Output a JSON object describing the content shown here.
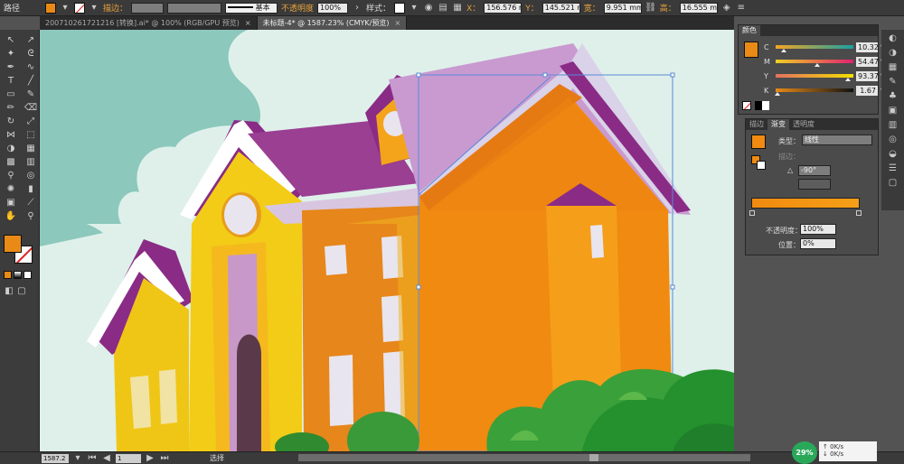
{
  "control_bar": {
    "type_label": "路径",
    "stroke_label": "描边：",
    "stroke_style_label": "基本",
    "opacity_label": "不透明度",
    "opacity_value": "100%",
    "style_label": "样式：",
    "x_label": "X：",
    "x_value": "156.576 r",
    "y_label": "Y：",
    "y_value": "145.521 r",
    "w_label": "宽：",
    "w_value": "9.951 mm",
    "h_label": "高：",
    "h_value": "16.555 mm",
    "fill_color": "#e98a17",
    "stroke_color": "#ffffff"
  },
  "tabs": [
    {
      "label": "20071026172121​6 [转换].ai* @ 100% (RGB/GPU 预览)",
      "active": false
    },
    {
      "label": "未标题-4* @ 1587.23% (CMYK/预览)",
      "active": true
    }
  ],
  "tab_close": "×",
  "color_panel": {
    "title": "颜色",
    "swatch": "#e98a17",
    "sliders": [
      {
        "label": "C",
        "value": "10.32",
        "unit": "%",
        "pos": 0.1,
        "grad": "linear-gradient(to right,#f4a623,#1aa0a0)"
      },
      {
        "label": "M",
        "value": "54.47",
        "unit": "%",
        "pos": 0.54,
        "grad": "linear-gradient(to right,#f0d023,#e02070)"
      },
      {
        "label": "Y",
        "value": "93.37",
        "unit": "%",
        "pos": 0.93,
        "grad": "linear-gradient(to right,#e67060,#f2e000)"
      },
      {
        "label": "K",
        "value": "1.67",
        "unit": "%",
        "pos": 0.02,
        "grad": "linear-gradient(to right,#e98a17,#111)"
      }
    ]
  },
  "gradient_panel": {
    "tabs": [
      "描边",
      "渐变",
      "透明度"
    ],
    "active_tab": 1,
    "type_label": "类型：",
    "type_value": "线性",
    "stroke_label": "描边：",
    "angle_value": "-90°",
    "opacity_label": "不透明度：",
    "opacity_value": "100%",
    "position_label": "位置：",
    "position_value": "0%",
    "bar_start": "#f08a10",
    "bar_end": "#f5a018"
  },
  "status_bar": {
    "zoom": "1587.2",
    "page": "1",
    "tool": "选择"
  },
  "net_monitor": {
    "percent": "29%",
    "up": "0K/s",
    "down": "0K/s"
  },
  "colors": {
    "roof": "#9a3f92",
    "roof_light": "#c898c8",
    "wall_yellow": "#f2cc16",
    "wall_orange": "#f08a10",
    "sky": "#dfeee9",
    "tree": "#3a9a3a"
  }
}
